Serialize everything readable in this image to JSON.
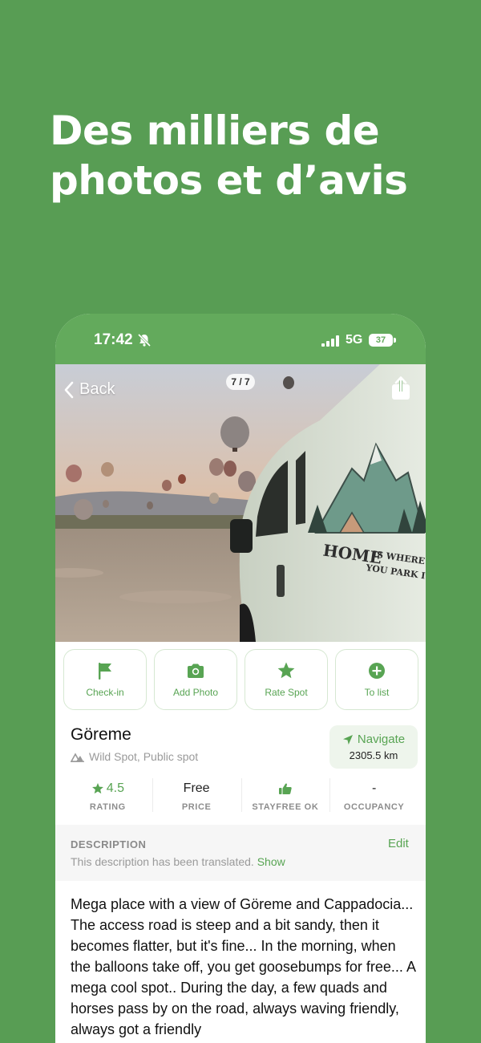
{
  "headline": {
    "line1": "Des milliers de",
    "line2": "photos et d’avis"
  },
  "status_bar": {
    "time": "17:42",
    "network": "5G",
    "battery": "37"
  },
  "photo": {
    "back_label": "Back",
    "counter": "7 / 7",
    "van_text_line1": "HOME",
    "van_text_line2": "IS WHERE",
    "van_text_line3": "YOU PARK IT"
  },
  "actions": [
    {
      "label": "Check-in",
      "icon": "flag-icon"
    },
    {
      "label": "Add Photo",
      "icon": "camera-icon"
    },
    {
      "label": "Rate Spot",
      "icon": "star-icon"
    },
    {
      "label": "To list",
      "icon": "plus-circle-icon"
    }
  ],
  "spot": {
    "name": "Göreme",
    "type": "Wild Spot, Public spot"
  },
  "navigate": {
    "label": "Navigate",
    "distance": "2305.5 km"
  },
  "stats": {
    "rating": {
      "value": "4.5",
      "label": "RATING"
    },
    "price": {
      "value": "Free",
      "label": "PRICE"
    },
    "stayfree": {
      "label": "STAYFREE OK"
    },
    "occupancy": {
      "value": "-",
      "label": "OCCUPANCY"
    }
  },
  "description": {
    "heading": "DESCRIPTION",
    "edit_label": "Edit",
    "translated_note": "This description has been translated.",
    "show_label": "Show",
    "text": "Mega place with a view of Göreme and Cappadocia... The access road is steep and a bit sandy, then it becomes flatter, but it's fine... In the morning, when the balloons take off, you get goosebumps for free... A mega cool spot.. During the day, a few quads and horses pass by on the road, always waving friendly, always got a friendly"
  },
  "colors": {
    "background": "#589d54",
    "accent": "#58a453",
    "status_bar": "#63aa5c"
  }
}
